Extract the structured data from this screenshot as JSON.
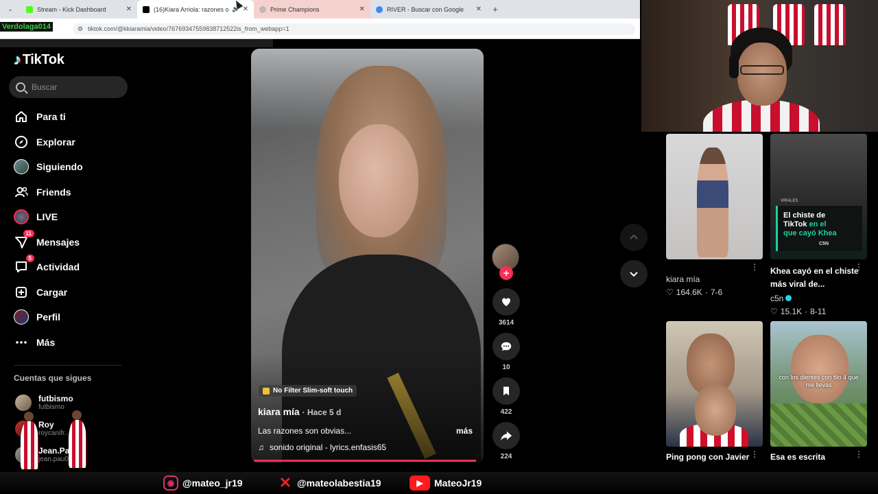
{
  "browser": {
    "tabs": [
      {
        "title": "Stream - Kick Dashboard",
        "color": "#53fc18",
        "active": false,
        "highlighted": false
      },
      {
        "title": "(16)Kiara Arriola: razones ol",
        "color": "#000000",
        "active": true,
        "highlighted": false
      },
      {
        "title": "Prime Champions",
        "color": "#c2b7b7",
        "active": false,
        "highlighted": true
      },
      {
        "title": "RIVER - Buscar con Google",
        "color": "#4285f4",
        "active": false,
        "highlighted": false
      }
    ],
    "url": "tiktok.com/@kkiaramia/video/76769347559838712522is_from_webapp=1",
    "new_tab": "+"
  },
  "streamer_name": "Verdolaga014",
  "sidebar": {
    "logo": "TikTok",
    "search_placeholder": "Buscar",
    "nav": [
      {
        "label": "Para ti",
        "icon": "home-icon",
        "glyph": "⌂",
        "badge": ""
      },
      {
        "label": "Explorar",
        "icon": "compass-icon",
        "glyph": "◎",
        "badge": ""
      },
      {
        "label": "Siguiendo",
        "icon": "following-avatar-icon",
        "glyph": "",
        "badge": ""
      },
      {
        "label": "Friends",
        "icon": "friends-icon",
        "glyph": "⚇",
        "badge": ""
      },
      {
        "label": "LIVE",
        "icon": "live-avatar-icon",
        "glyph": "",
        "badge": ""
      },
      {
        "label": "Mensajes",
        "icon": "messages-icon",
        "glyph": "⧩",
        "badge": "11"
      },
      {
        "label": "Actividad",
        "icon": "activity-icon",
        "glyph": "☐",
        "badge": "5"
      },
      {
        "label": "Cargar",
        "icon": "upload-icon",
        "glyph": "⊞",
        "badge": ""
      },
      {
        "label": "Perfil",
        "icon": "profile-avatar-icon",
        "glyph": "",
        "badge": ""
      },
      {
        "label": "Más",
        "icon": "more-icon",
        "glyph": "···",
        "badge": ""
      }
    ],
    "following_title": "Cuentas que sigues",
    "accounts": [
      {
        "name": "futbismo",
        "handle": "futbismo"
      },
      {
        "name": "Roy",
        "handle": "roycanifr..."
      },
      {
        "name": "Jean.Paul",
        "handle": "jean.pau07"
      }
    ]
  },
  "video": {
    "filter": "No Filter Slim-soft touch",
    "author": "kiara mía",
    "time": "· Hace 5 d",
    "caption": "Las razones son obvias...",
    "more": "más",
    "sound": "sonido original - lyrics.enfasis65",
    "progress": 0.98
  },
  "actions": {
    "likes": "3614",
    "comments": "10",
    "saves": "422",
    "shares": "224",
    "follow_plus": "+"
  },
  "recommendations": [
    {
      "title": "",
      "author": "kiara mía",
      "likes": "164.6K",
      "date": "7-6"
    },
    {
      "title": "Khea cayó en el chiste más viral de...",
      "author": "c5n",
      "likes": "15.1K",
      "date": "8-11",
      "thumb_tag": "VIRALES",
      "thumb_line1": "El chiste de",
      "thumb_line2": "TikTok",
      "thumb_line2b": "en el",
      "thumb_line3": "que cayó Khea",
      "thumb_logo": "C5N"
    },
    {
      "title": "Ping pong con Javier",
      "author": "",
      "likes": "",
      "date": ""
    },
    {
      "title": "Esa es escrita",
      "author": "",
      "likes": "",
      "date": "",
      "thumb_text": "con los dientes con filo 4 que me llevas"
    }
  ],
  "social": {
    "instagram": "@mateo_jr19",
    "x": "@mateolabestia19",
    "youtube": "MateoJr19"
  },
  "colors": {
    "accent": "#fe2c55",
    "teal": "#25f4ee",
    "kick_green": "#35d03b"
  }
}
